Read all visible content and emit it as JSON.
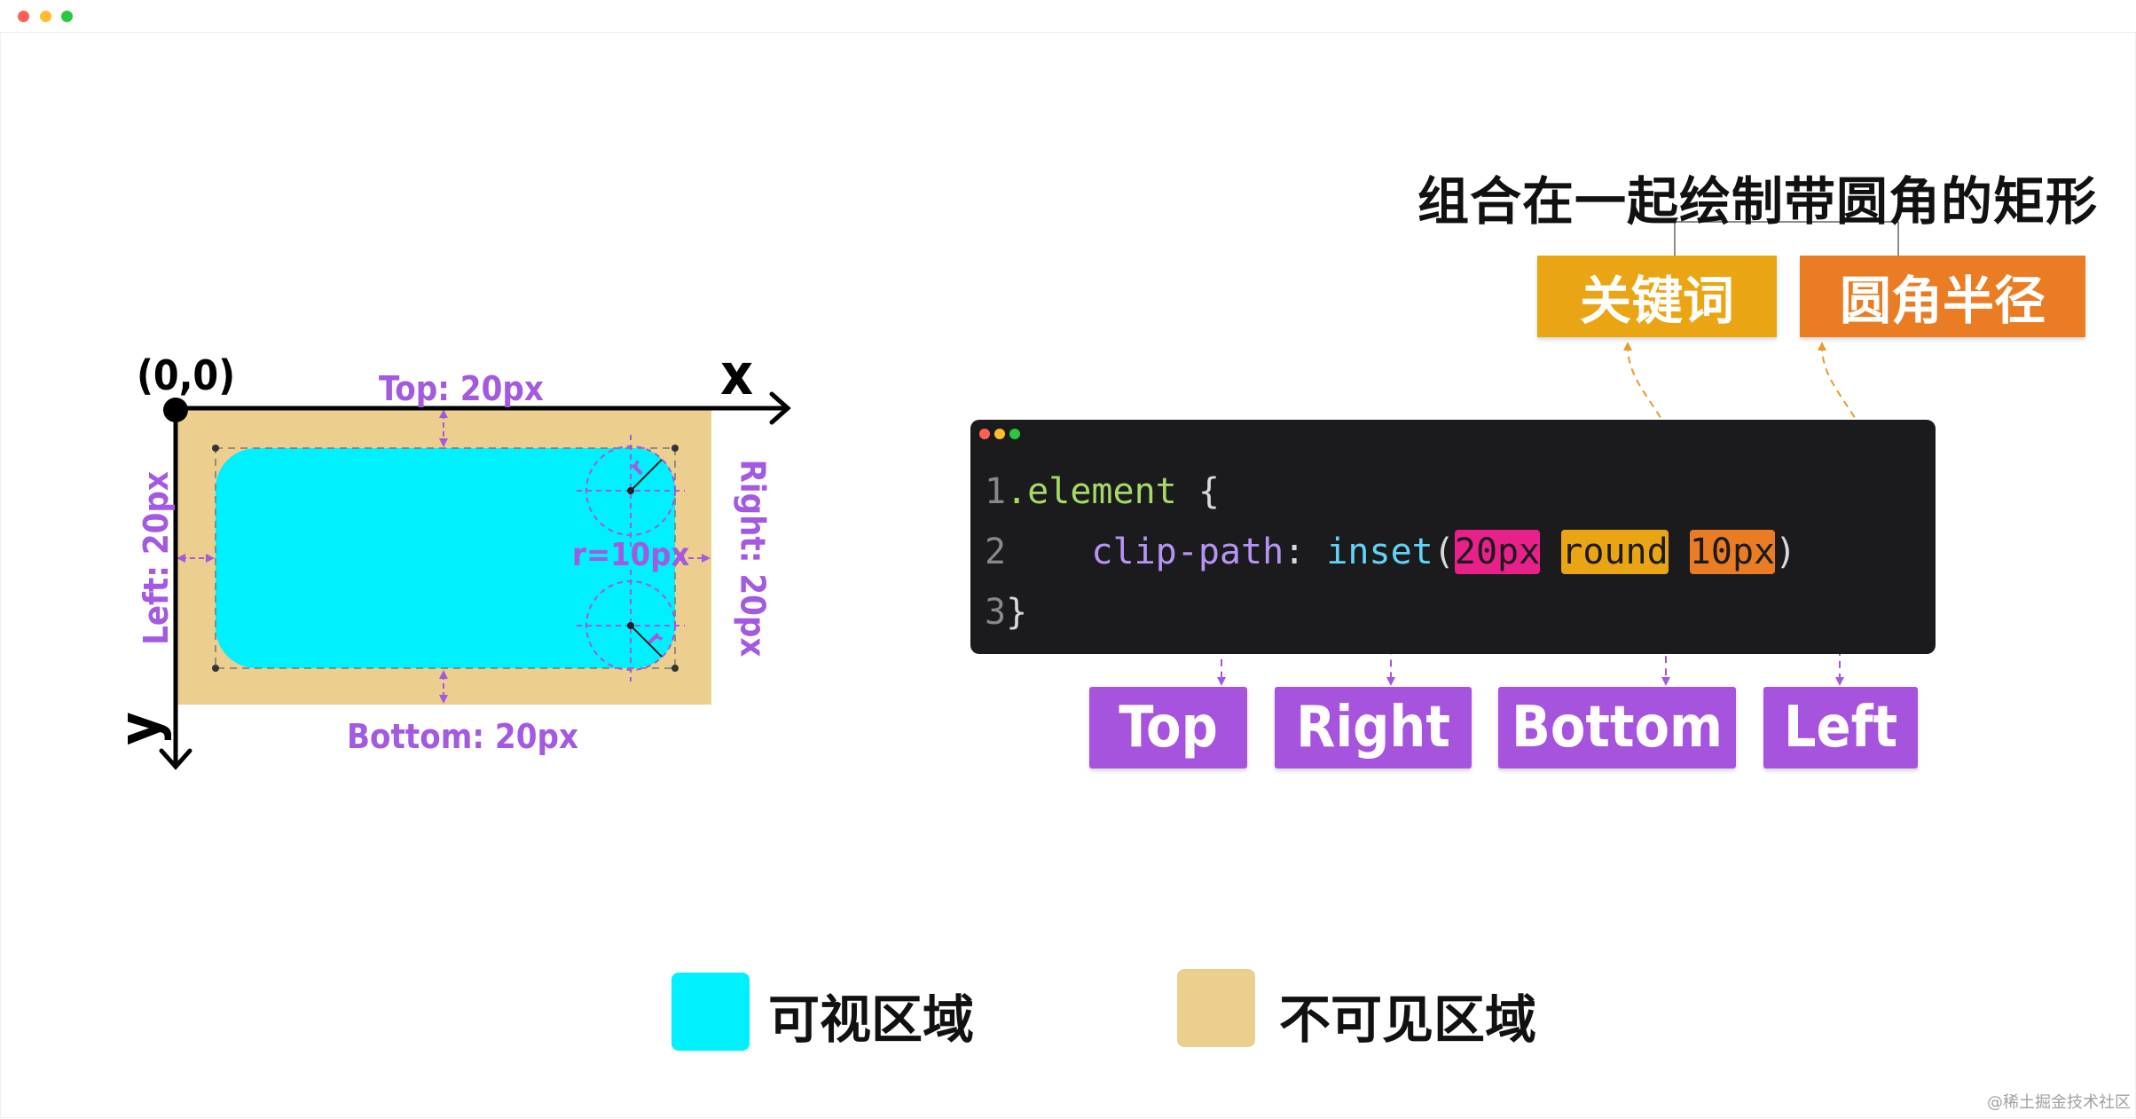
{
  "window": {
    "dots": [
      {
        "name": "close",
        "color": "#fe5f57"
      },
      {
        "name": "minimize",
        "color": "#febc2e"
      },
      {
        "name": "maximize",
        "color": "#28c840"
      }
    ]
  },
  "diagram": {
    "origin": "(0,0)",
    "x_axis": "x",
    "y_axis": "y",
    "labels": {
      "top": "Top: 20px",
      "bottom": "Bottom: 20px",
      "left": "Left: 20px",
      "right": "Right: 20px",
      "radius": "r=10px",
      "corner_r_top": "r",
      "corner_r_bottom": "r"
    },
    "colors": {
      "visible": "#00f0ff",
      "invisible": "#ecce8e",
      "annotation": "#a359e0"
    }
  },
  "header": {
    "title": "组合在一起绘制带圆角的矩形",
    "tags": [
      {
        "label": "关键词",
        "color": "#eaa514"
      },
      {
        "label": "圆角半径",
        "color": "#ea7d24"
      }
    ]
  },
  "code": {
    "dot_colors": [
      "#fe5f57",
      "#febc2e",
      "#28c840"
    ],
    "line1": {
      "num": "1",
      "text": ".element",
      "brace": " {"
    },
    "line2": {
      "num": "2",
      "indent": "    ",
      "prop": "clip-path",
      "colon": ": ",
      "func": "inset",
      "open": "(",
      "arg_value": "20px",
      "arg_keyword": "round",
      "arg_radius": "10px",
      "close": ")"
    },
    "line3": {
      "num": "3",
      "brace": "}"
    },
    "colors": {
      "value_bg": "#e8208a",
      "keyword_bg": "#eaa514",
      "radius_bg": "#ea7d24",
      "selector": "#a6d96a",
      "property": "#b794f4",
      "function": "#61d4f5"
    }
  },
  "sides": [
    {
      "label": "Top"
    },
    {
      "label": "Right"
    },
    {
      "label": "Bottom"
    },
    {
      "label": "Left"
    }
  ],
  "side_color": "#a653dd",
  "legend": [
    {
      "label": "可视区域",
      "color": "#00f0ff"
    },
    {
      "label": "不可见区域",
      "color": "#ecce8e"
    }
  ],
  "watermark": "@稀土掘金技术社区"
}
